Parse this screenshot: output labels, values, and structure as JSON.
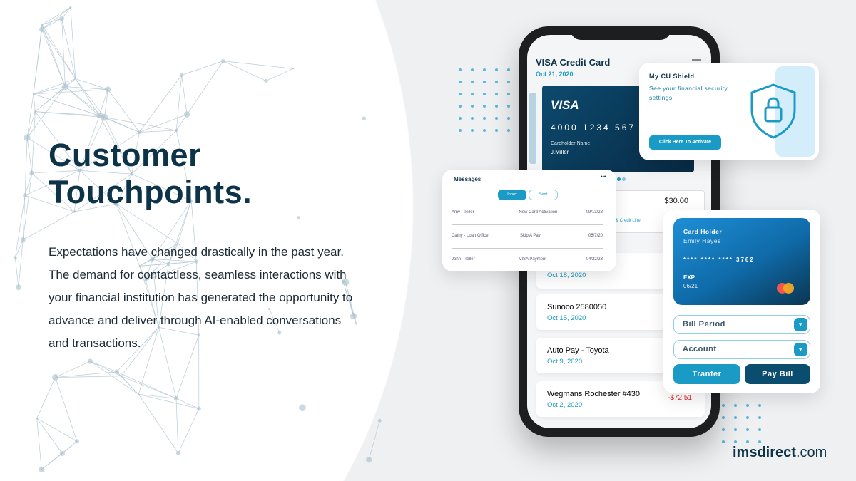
{
  "headline": {
    "line1": "Customer",
    "line2": "Touchpoints."
  },
  "body": "Expectations have changed drastically in the past year. The demand for contactless, seamless interactions with your financial institution has generated the opportunity to advance and deliver through AI-enabled conversations and transactions.",
  "phone": {
    "title": "VISA Credit Card",
    "date": "Oct 21, 2020",
    "card": {
      "brand": "VISA",
      "number": "4000 1234 567",
      "holder_label": "Cardholder Name",
      "holder": "J.Miller"
    },
    "balance": "$30.00",
    "credit_line": "& Credit Line",
    "transactions": [
      {
        "name": "",
        "date": "Oct 18, 2020",
        "amount": ""
      },
      {
        "name": "Sunoco 2580050",
        "date": "Oct 15, 2020",
        "amount": ""
      },
      {
        "name": "Auto Pay - Toyota",
        "date": "Oct 9, 2020",
        "amount": ""
      },
      {
        "name": "Wegmans Rochester #430",
        "date": "Oct 2, 2020",
        "amount": "-$72.51"
      }
    ]
  },
  "messages": {
    "title": "Messages",
    "more": "•••",
    "tabs": [
      "Inbox",
      "Sent"
    ],
    "rows": [
      [
        "Amy - Teller",
        "New Card Activation",
        "09/13/23"
      ],
      [
        "Cathy - Loan Office",
        "Skip A Pay",
        "05/7/20"
      ],
      [
        "John - Teller",
        "VISA Payment",
        "04/22/23"
      ]
    ]
  },
  "shield": {
    "title": "My CU Shield",
    "desc": "See your financial security settings",
    "button": "Click Here To Activate"
  },
  "pay": {
    "holder_label": "Card Holder",
    "holder": "Emily Hayes",
    "number": "**** **** **** 3762",
    "exp_label": "EXP",
    "exp": "06/21",
    "bill_period": "Bill Period",
    "account": "Account",
    "transfer": "Tranfer",
    "pay_bill": "Pay Bill"
  },
  "logo": {
    "bold": "imsdirect",
    "rest": ".com"
  },
  "colors": {
    "navy": "#0d3349",
    "accent": "#1a9bc6",
    "dark_button": "#0a4d6e",
    "negative": "#e0252a"
  }
}
